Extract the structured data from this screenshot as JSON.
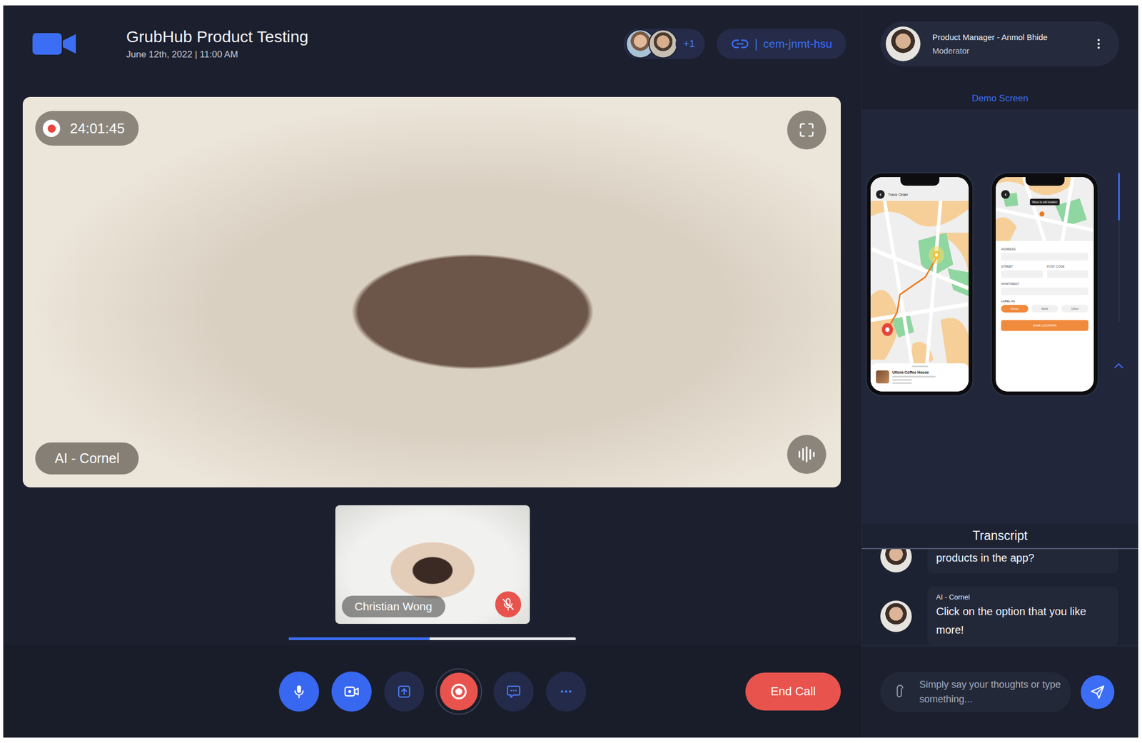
{
  "meeting": {
    "title": "GrubHub Product Testing",
    "datetime": "June 12th, 2022 | 11:00 AM"
  },
  "participants": {
    "avatars": 2,
    "more": "+1"
  },
  "link": {
    "separator": "|",
    "code": "cem-jnmt-hsu"
  },
  "moderator": {
    "title": "Product Manager - Anmol Bhide",
    "role": "Moderator"
  },
  "main_video": {
    "recording": true,
    "timer": "24:01:45",
    "name": "AI - Cornel",
    "speaking": true
  },
  "self_video": {
    "name": "Christian Wong",
    "muted": true
  },
  "playback": {
    "level": 0.49
  },
  "controls": [
    {
      "kind": "mic",
      "on": true
    },
    {
      "kind": "camera",
      "on": true
    },
    {
      "kind": "share",
      "on": false
    },
    {
      "kind": "record",
      "on": true
    },
    {
      "kind": "chat",
      "on": false
    },
    {
      "kind": "more",
      "on": false
    }
  ],
  "end_call": "End Call",
  "demo": {
    "title": "Demo Screen",
    "scroll": {
      "level": 0.32
    },
    "screens": [
      {
        "kind": "track",
        "title": "Track Order",
        "place": "Uttora Coffee House"
      },
      {
        "kind": "address",
        "tooltip": "Move to edit location",
        "fields": [
          {
            "label": "ADDRESS",
            "half": false
          },
          {
            "label": "STREET",
            "half": true
          },
          {
            "label": "POST CODE",
            "half": true
          },
          {
            "label": "APARTMENT",
            "half": false
          }
        ],
        "label_title": "LABEL AS",
        "labels": [
          {
            "text": "Home",
            "selected": true
          },
          {
            "text": "Work",
            "selected": false
          },
          {
            "text": "Other",
            "selected": false
          }
        ],
        "button": "SAVE LOCATION"
      }
    ]
  },
  "transcript": {
    "title": "Transcript",
    "messages": [
      {
        "kind": "partial",
        "author": "",
        "text": "products in the app?"
      },
      {
        "kind": "full",
        "author": "AI - Cornel",
        "text": "Click on the option that you like more!"
      }
    ]
  },
  "composer": {
    "placeholder": "Simply say your thoughts or type something..."
  }
}
